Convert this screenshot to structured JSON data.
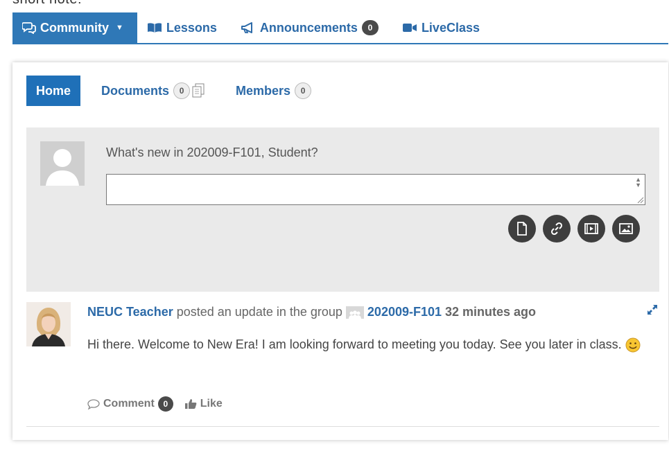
{
  "header_text": "short note:",
  "top_tabs": [
    {
      "label": "Community",
      "icon": "chat-bubbles-icon",
      "active": true
    },
    {
      "label": "Lessons",
      "icon": "book-icon"
    },
    {
      "label": "Announcements",
      "icon": "megaphone-icon",
      "count": "0"
    },
    {
      "label": "LiveClass",
      "icon": "video-camera-icon"
    }
  ],
  "sub_tabs": [
    {
      "label": "Home",
      "active": true
    },
    {
      "label": "Documents",
      "count": "0",
      "icon": "documents-icon"
    },
    {
      "label": "Members",
      "count": "0"
    }
  ],
  "post_box": {
    "prompt": "What's new in 202009-F101, Student?",
    "value": "",
    "attach_buttons": [
      "document-icon",
      "link-icon",
      "video-icon",
      "image-icon"
    ]
  },
  "activity": {
    "author": "NEUC Teacher",
    "action_text": "posted an update in the group",
    "group": "202009-F101",
    "time": "32 minutes ago",
    "content": "Hi there. Welcome to New Era! I am looking forward to meeting you today. See you later in class.",
    "comment_label": "Comment",
    "comment_count": "0",
    "like_label": "Like"
  },
  "colors": {
    "accent": "#2f78b7",
    "link": "#2c6aa8",
    "postbox_bg": "#eaeaea",
    "dark_button": "#3e3e3e"
  }
}
